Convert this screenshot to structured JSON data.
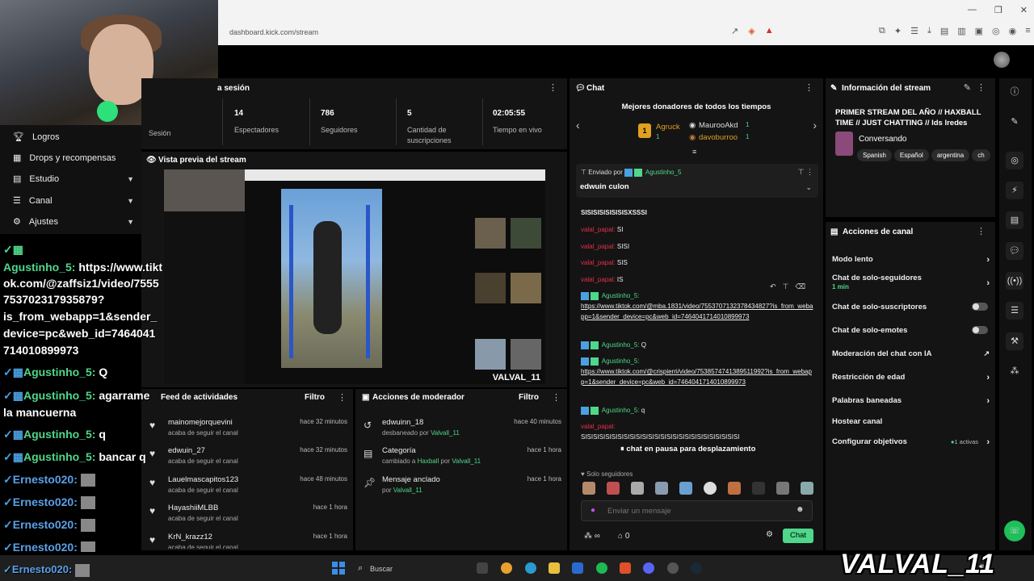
{
  "browser": {
    "url": "dashboard.kick.com/stream"
  },
  "left_nav": {
    "items": [
      {
        "label": "Logros",
        "icon": "trophy-icon",
        "chevron": false
      },
      {
        "label": "Drops y recompensas",
        "icon": "gift-icon",
        "chevron": false
      },
      {
        "label": "Estudio",
        "icon": "grid-icon",
        "chevron": true
      },
      {
        "label": "Canal",
        "icon": "menu-icon",
        "chevron": true
      },
      {
        "label": "Ajustes",
        "icon": "gear-icon",
        "chevron": true
      }
    ]
  },
  "overlay_chat": {
    "lines": [
      {
        "name": "Agustinho_5:",
        "text": "https://www.tikt"
      },
      {
        "name": "",
        "text": "ok.com/@zaffsiz1/video/7555"
      },
      {
        "name": "",
        "text": "753702317935879?"
      },
      {
        "name": "",
        "text": "is_from_webapp=1&sender_"
      },
      {
        "name": "",
        "text": "device=pc&web_id=7464041"
      },
      {
        "name": "",
        "text": "714010899973"
      },
      {
        "name": "Agustinho_5:",
        "text": "Q"
      },
      {
        "name": "Agustinho_5:",
        "text": "agarrame"
      },
      {
        "name": "",
        "text": "la mancuerna"
      },
      {
        "name": "Agustinho_5:",
        "text": "q"
      },
      {
        "name": "Agustinho_5:",
        "text": "bancar q"
      },
      {
        "name": "Ernesto020:",
        "text": ""
      },
      {
        "name": "Ernesto020:",
        "text": ""
      },
      {
        "name": "Ernesto020:",
        "text": ""
      },
      {
        "name": "Ernesto020:",
        "text": ""
      },
      {
        "name": "Ernesto020:",
        "text": ""
      }
    ]
  },
  "session": {
    "title_partial": "a sesión",
    "first_label": "Sesión",
    "stats": [
      {
        "value": "14",
        "label": "Espectadores"
      },
      {
        "value": "786",
        "label": "Seguidores"
      },
      {
        "value": "5",
        "label": "Cantidad de suscripciones"
      },
      {
        "value": "02:05:55",
        "label": "Tiempo en vivo"
      }
    ]
  },
  "preview": {
    "title": "Vista previa del stream",
    "watermark": "VALVAL_11"
  },
  "activity": {
    "title": "Feed de actividades",
    "filter": "Filtro",
    "rows": [
      {
        "name": "mainomejorquevini",
        "sub": "acaba de seguir el canal",
        "time": "hace 32 minutos"
      },
      {
        "name": "edwuin_27",
        "sub": "acaba de seguir el canal",
        "time": "hace 32 minutos"
      },
      {
        "name": "Lauelmascapitos123",
        "sub": "acaba de seguir el canal",
        "time": "hace 48 minutos"
      },
      {
        "name": "HayashiiMLBB",
        "sub": "acaba de seguir el canal",
        "time": "hace 1 hora"
      },
      {
        "name": "KrN_krazz12",
        "sub": "acaba de seguir el canal",
        "time": "hace 1 hora"
      }
    ]
  },
  "mod_actions": {
    "title": "Acciones de moderador",
    "filter": "Filtro",
    "rows": [
      {
        "name": "edwuinn_18",
        "sub_pre": "desbaneado por",
        "sub_a": "Valvall_11",
        "sub_mid": "",
        "sub_b": "",
        "time": "hace 40 minutos",
        "icon": "undo-icon"
      },
      {
        "name": "Categoría",
        "sub_pre": "cambiado a",
        "sub_a": "Haxball",
        "sub_mid": "por",
        "sub_b": "Valvall_11",
        "time": "hace 1 hora",
        "icon": "category-icon"
      },
      {
        "name": "Mensaje anclado",
        "sub_pre": "por",
        "sub_a": "Valvall_11",
        "sub_mid": "",
        "sub_b": "",
        "time": "hace 1 hora",
        "icon": "pin-icon"
      }
    ]
  },
  "chat": {
    "title": "Chat",
    "donors_title": "Mejores donadores de todos los tiempos",
    "donors": [
      {
        "rank": "1",
        "name": "Agruck",
        "count": "1"
      },
      {
        "name": "MaurooAkd",
        "count": "1"
      },
      {
        "name": "davoburroo",
        "count": "1"
      }
    ],
    "pinned_by_label": "Enviado por",
    "pinned_by_user": "Agustinho_5",
    "pinned_text": "edwuin culon",
    "top_text": "SISISISISISISISXSSSI",
    "short_msgs": [
      {
        "user": "valal_papal:",
        "text": " SI"
      },
      {
        "user": "valal_papal:",
        "text": " SISI"
      },
      {
        "user": "valal_papal:",
        "text": " SIS"
      },
      {
        "user": "valal_papal:",
        "text": " IS"
      }
    ],
    "msg1_user": "Agustinho_5:",
    "msg1_link": "https://www.tiktok.com/@mba.1831/video/7553707132378434827?is_from_webapp=1&sender_device=pc&web_id=7464041714010899973",
    "msg2_user": "Agustinho_5:",
    "msg2_text": " Q",
    "msg3_user": "Agustinho_5:",
    "msg3_link": "https://www.tiktok.com/@crispierri/video/7538574741389511992?is_from_webapp=1&sender_device=pc&web_id=7464041714010899973",
    "msg4_user": "Agustinho_5:",
    "msg4_text": " q",
    "msg5_user": "valal_papal:",
    "msg5_text": "SISISISISISISISISISISISISISISISISISISISISISISISISISI",
    "pause_text": "chat en pausa para desplazamiento",
    "followers_only": "Solo seguidores",
    "input_placeholder": "Enviar un mensaje",
    "chat_button": "Chat",
    "points": "∞",
    "gifts": "0"
  },
  "stream_info": {
    "title": "Información del stream",
    "stream_title": "PRIMER STREAM DEL AÑO // HAXBALL TIME // JUST CHATTING // lds lredes",
    "category": "Conversando",
    "tags": [
      "Spanish",
      "Español",
      "argentina",
      "ch"
    ]
  },
  "channel_actions": {
    "title": "Acciones de canal",
    "items": [
      {
        "label": "Modo lento",
        "sub": "",
        "control": "chevron"
      },
      {
        "label": "Chat de solo-seguidores",
        "sub": "1 min",
        "control": "chevron"
      },
      {
        "label": "Chat de solo-suscriptores",
        "sub": "",
        "control": "toggle"
      },
      {
        "label": "Chat de solo-emotes",
        "sub": "",
        "control": "toggle"
      },
      {
        "label": "Moderación del chat con IA",
        "sub": "",
        "control": "external"
      },
      {
        "label": "Restricción de edad",
        "sub": "",
        "control": "chevron"
      },
      {
        "label": "Palabras baneadas",
        "sub": "",
        "control": "chevron"
      },
      {
        "label": "Hostear canal",
        "sub": "",
        "control": "none"
      },
      {
        "label": "Configurar objetivos",
        "sub": "",
        "control": "chevron",
        "badge": "1 activas"
      }
    ]
  },
  "taskbar": {
    "search_placeholder": "Buscar"
  },
  "colors": {
    "accent": "#4fd78a",
    "panel": "#141414",
    "danger": "#e0304a"
  }
}
